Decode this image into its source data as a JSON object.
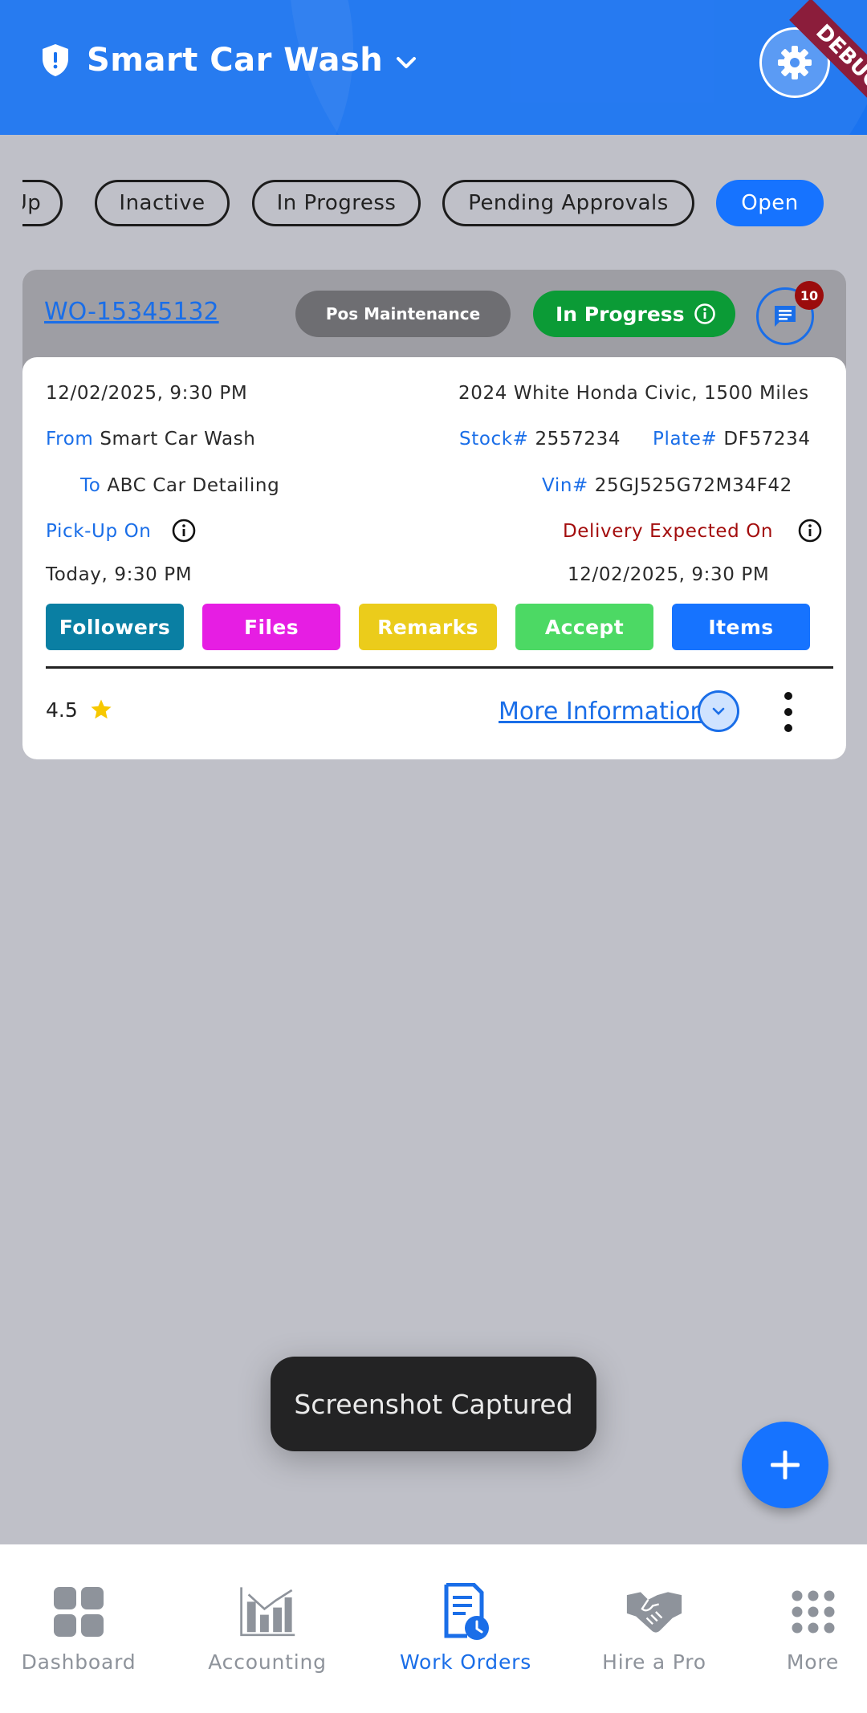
{
  "header": {
    "title": "Smart Car Wash",
    "debug_label": "DEBUG"
  },
  "filters": {
    "items": [
      "Up",
      "Inactive",
      "In Progress",
      "Pending Approvals",
      "Open"
    ],
    "active": "Open"
  },
  "work_order": {
    "id": "WO-15345132",
    "type_badge": "Pos Maintenance",
    "status": "In Progress",
    "messages_count": "10",
    "created": "12/02/2025, 9:30 PM",
    "vehicle": "2024 White Honda Civic, 1500 Miles",
    "from_label": "From",
    "from_value": "Smart Car Wash",
    "to_label": "To",
    "to_value": "ABC Car Detailing",
    "stock_label": "Stock#",
    "stock_value": "2557234",
    "plate_label": "Plate#",
    "plate_value": "DF57234",
    "vin_label": "Vin#",
    "vin_value": "25GJ525G72M34F42",
    "pickup_label": "Pick-Up On",
    "pickup_value": "Today, 9:30 PM",
    "delivery_label": "Delivery Expected On",
    "delivery_value": "12/02/2025, 9:30 PM",
    "actions": [
      {
        "label": "Followers",
        "color": "#0a7fa3"
      },
      {
        "label": "Files",
        "color": "#e61ee3"
      },
      {
        "label": "Remarks",
        "color": "#ebcc1b"
      },
      {
        "label": "Accept",
        "color": "#4cd964"
      },
      {
        "label": "Items",
        "color": "#1673ff"
      }
    ],
    "rating": "4.5",
    "more_info_label": "More Information"
  },
  "toast": {
    "text": "Screenshot Captured"
  },
  "bottom_nav": {
    "items": [
      {
        "label": "Dashboard",
        "icon": "dashboard-icon"
      },
      {
        "label": "Accounting",
        "icon": "accounting-chart-icon"
      },
      {
        "label": "Work Orders",
        "icon": "work-orders-icon"
      },
      {
        "label": "Hire a Pro",
        "icon": "handshake-icon"
      },
      {
        "label": "More",
        "icon": "more-grid-icon"
      }
    ],
    "active": "Work Orders"
  },
  "colors": {
    "primary": "#1673ff",
    "header_bg": "#1a73f0",
    "status_green": "#0b9b36",
    "badge_red": "#9b0c0c",
    "delivery_red": "#a30d0d"
  }
}
